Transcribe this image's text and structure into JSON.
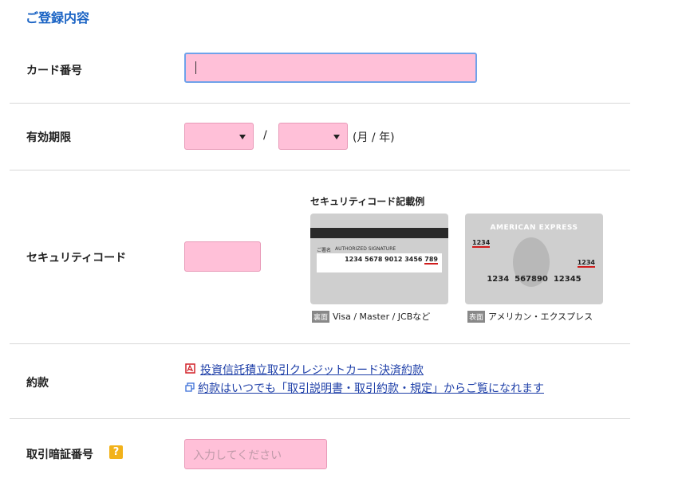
{
  "section_title": "ご登録内容",
  "labels": {
    "card_number": "カード番号",
    "expiry": "有効期限",
    "security_code": "セキュリティコード",
    "terms": "約款",
    "pin": "取引暗証番号"
  },
  "expiry": {
    "separator": "/",
    "unit_hint": "(月 / 年)"
  },
  "security_example": {
    "title": "セキュリティコード記載例",
    "visa": {
      "signature_label": "ご署名",
      "signature_text": "AUTHORIZED SIGNATURE",
      "number": "1234 5678 9012 3456",
      "code": "789",
      "tag": "裏面",
      "caption": "Visa / Master / JCBなど"
    },
    "amex": {
      "brand": "AMERICAN EXPRESS",
      "code_top": "1234",
      "code_right": "1234",
      "number": "1234  567890  12345",
      "tag": "表面",
      "caption": "アメリカン・エクスプレス"
    }
  },
  "terms_links": {
    "pdf": "投資信託積立取引クレジットカード決済約款",
    "info": "約款はいつでも「取引説明書・取引約款・規定」からご覧になれます"
  },
  "pin": {
    "placeholder": "入力してください",
    "help_icon_text": "?"
  },
  "colors": {
    "title_blue": "#1a63c4",
    "input_pink": "#ffc0d8",
    "link_blue": "#1e3fa8",
    "help_yellow": "#f2b21a",
    "underline_red": "#d01c1c"
  }
}
